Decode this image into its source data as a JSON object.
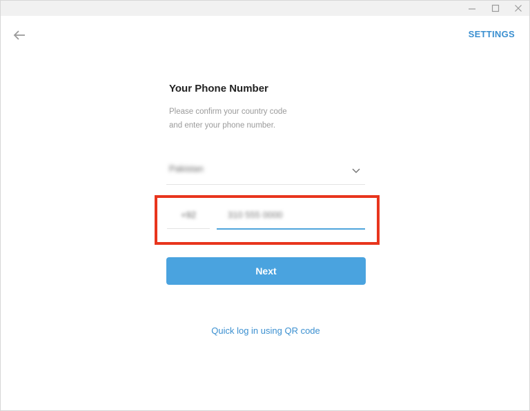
{
  "window": {
    "minimize_icon": "minimize-icon",
    "maximize_icon": "maximize-icon",
    "close_icon": "close-icon"
  },
  "header": {
    "back_icon": "arrow-left-icon",
    "settings_label": "SETTINGS"
  },
  "form": {
    "title": "Your Phone Number",
    "description_line1": "Please confirm your country code",
    "description_line2": "and enter your phone number.",
    "country_value": "Pakistan",
    "country_chevron_icon": "chevron-down-icon",
    "code_value": "+92",
    "phone_value": "310 555 0000",
    "next_label": "Next",
    "qr_link": "Quick log in using QR code"
  },
  "colors": {
    "accent": "#4aa3df",
    "link": "#3a8fd0",
    "highlight": "#e8351d"
  }
}
